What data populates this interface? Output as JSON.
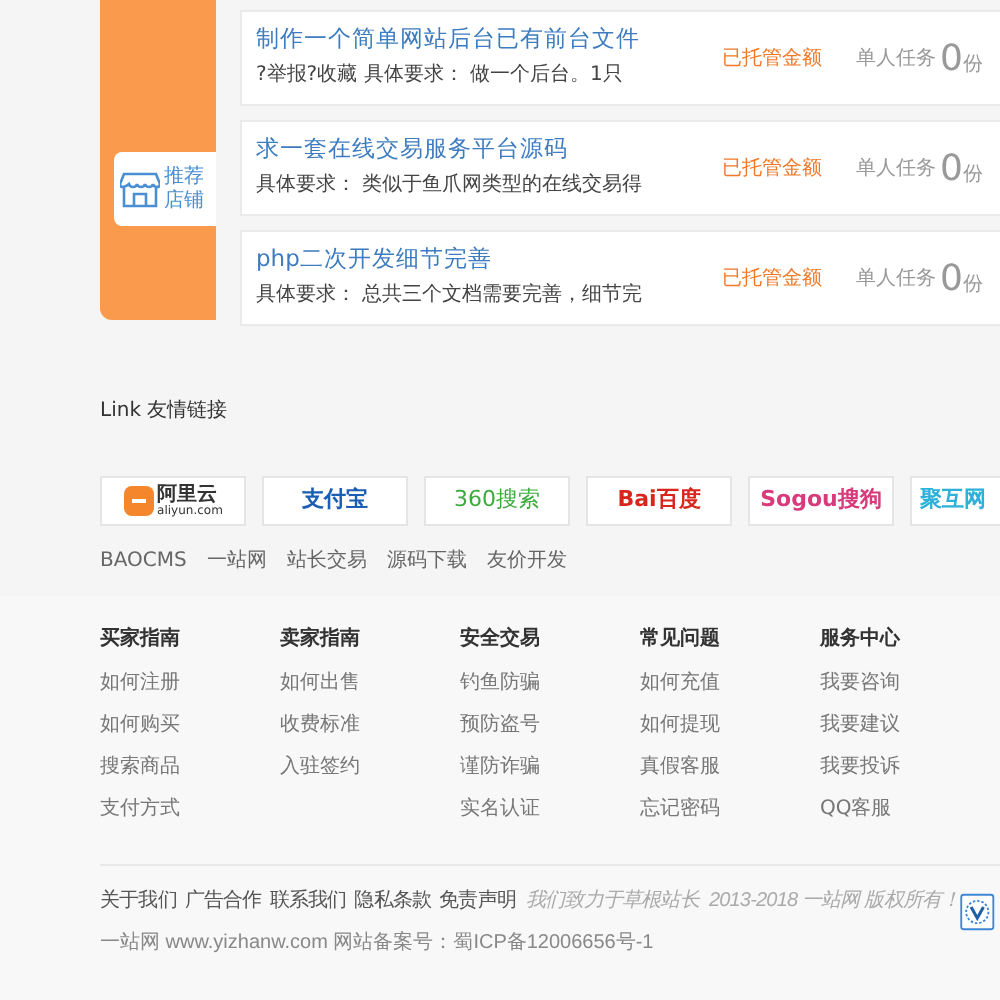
{
  "promo_tab": {
    "label": "推荐店铺"
  },
  "tasks": [
    {
      "title": "制作一个简单网站后台已有前台文件",
      "description": "?举报?收藏 具体要求： 做一个后台。1只",
      "status": "已托管金额",
      "type": "单人任务",
      "count": "0",
      "unit": "份"
    },
    {
      "title": "求一套在线交易服务平台源码",
      "description": "具体要求： 类似于鱼爪网类型的在线交易得",
      "status": "已托管金额",
      "type": "单人任务",
      "count": "0",
      "unit": "份"
    },
    {
      "title": "php二次开发细节完善",
      "description": "具体要求： 总共三个文档需要完善，细节完",
      "status": "已托管金额",
      "type": "单人任务",
      "count": "0",
      "unit": "份"
    }
  ],
  "links": {
    "heading": "Link 友情链接",
    "logos": [
      {
        "kind": "aliyun",
        "text": "阿里云",
        "sub": "aliyun.com",
        "color": "#333333"
      },
      {
        "kind": "alipay",
        "text": "支付宝",
        "color": "#1a5fb4"
      },
      {
        "kind": "so360",
        "text": "360搜索",
        "color": "#3cab3c"
      },
      {
        "kind": "baidu",
        "text": "Bai百度",
        "color": "#d9261c"
      },
      {
        "kind": "sogou",
        "text": "Sogou搜狗",
        "color": "#d93a7c"
      },
      {
        "kind": "juhu",
        "text": "聚互网",
        "color": "#2fb0d8"
      }
    ],
    "text_links": [
      "BAOCMS",
      "一站网",
      "站长交易",
      "源码下载",
      "友价开发"
    ]
  },
  "footer": {
    "columns": [
      {
        "heading": "买家指南",
        "items": [
          "如何注册",
          "如何购买",
          "搜索商品",
          "支付方式"
        ]
      },
      {
        "heading": "卖家指南",
        "items": [
          "如何出售",
          "收费标准",
          "入驻签约"
        ]
      },
      {
        "heading": "安全交易",
        "items": [
          "钓鱼防骗",
          "预防盗号",
          "谨防诈骗",
          "实名认证"
        ]
      },
      {
        "heading": "常见问题",
        "items": [
          "如何充值",
          "如何提现",
          "真假客服",
          "忘记密码"
        ]
      },
      {
        "heading": "服务中心",
        "items": [
          "我要咨询",
          "我要建议",
          "我要投诉",
          "QQ客服"
        ]
      }
    ],
    "bottom_links": [
      "关于我们",
      "广告合作",
      "联系我们",
      "隐私条款",
      "免责声明"
    ],
    "slogan": "我们致力于草根站长",
    "copyright": "2013-2018 一站网 版权所有！",
    "record": "一站网 www.yizhanw.com 网站备案号：蜀ICP备12006656号-1"
  }
}
